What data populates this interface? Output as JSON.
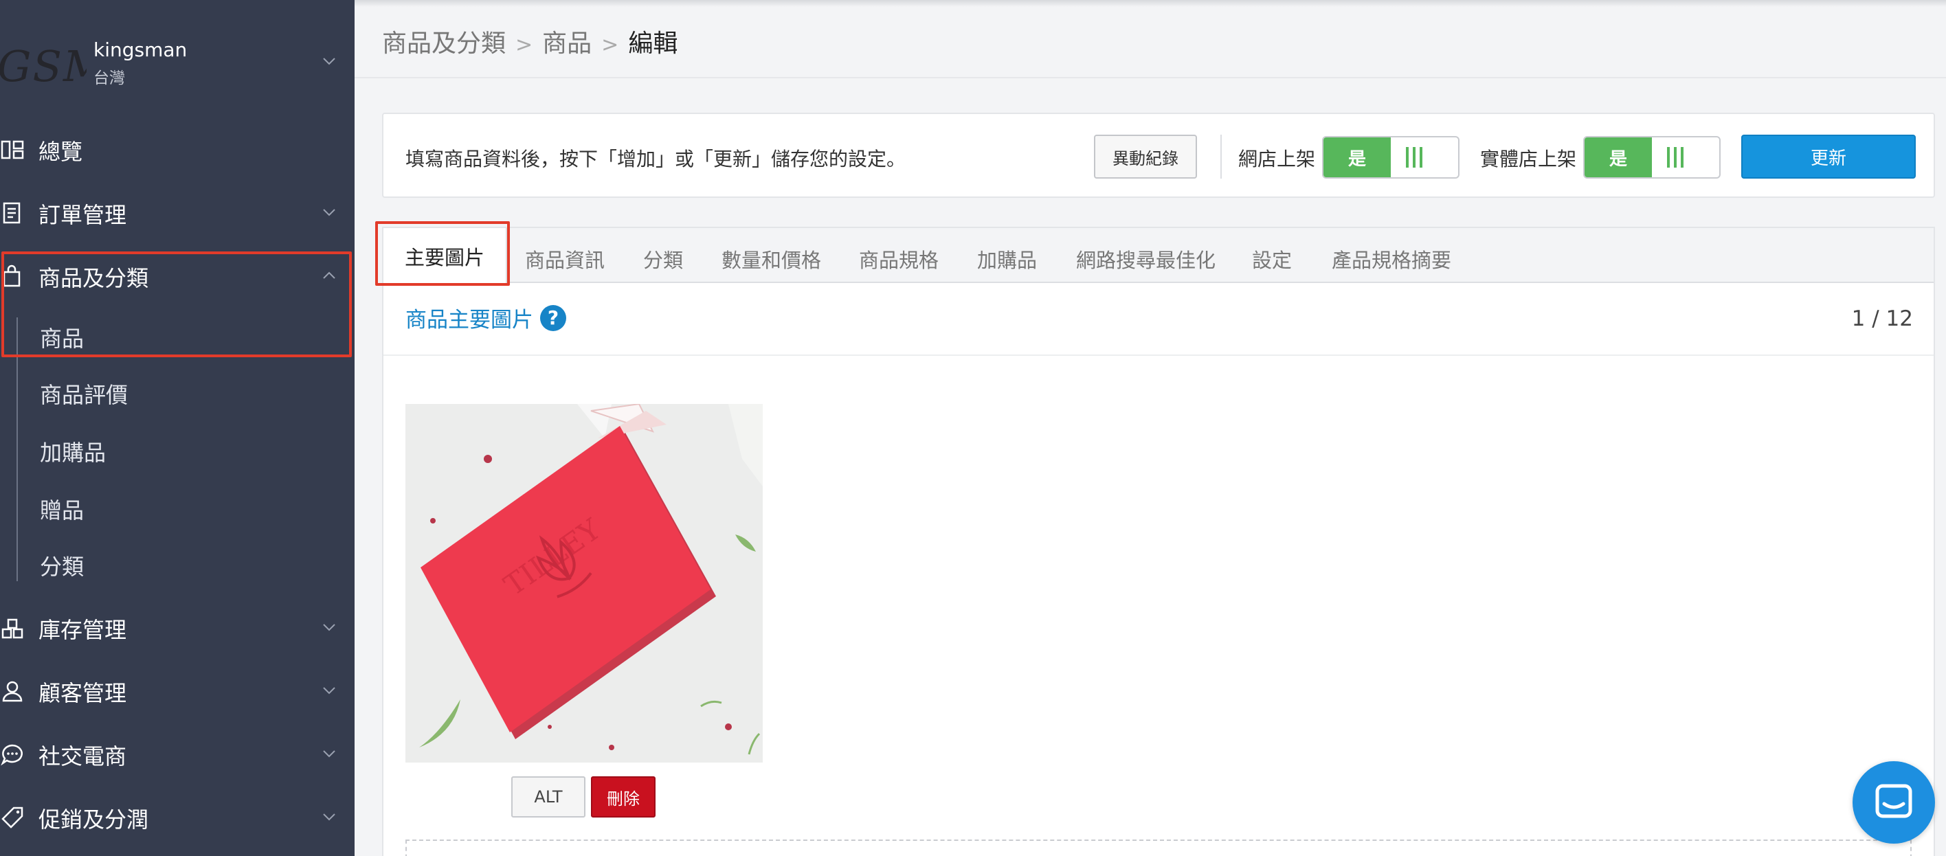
{
  "store": {
    "logo_text": "GSM",
    "name": "kingsman",
    "region": "台灣"
  },
  "sidebar": {
    "items": [
      {
        "label": "總覽",
        "icon": "dashboard-icon"
      },
      {
        "label": "訂單管理",
        "icon": "receipt-icon"
      },
      {
        "label": "商品及分類",
        "icon": "shopping-bag-icon",
        "expanded": true
      },
      {
        "label": "庫存管理",
        "icon": "inventory-icon"
      },
      {
        "label": "顧客管理",
        "icon": "user-icon"
      },
      {
        "label": "社交電商",
        "icon": "chat-icon"
      },
      {
        "label": "促銷及分潤",
        "icon": "tag-icon"
      }
    ],
    "subitems": [
      "商品",
      "商品評價",
      "加購品",
      "贈品",
      "分類"
    ]
  },
  "breadcrumb": {
    "items": [
      "商品及分類",
      "商品"
    ],
    "current": "編輯"
  },
  "action_bar": {
    "instruction": "填寫商品資料後，按下「增加」或「更新」儲存您的設定。",
    "history_button": "異動紀錄",
    "online_label": "網店上架",
    "online_value": "是",
    "store_label": "實體店上架",
    "store_value": "是",
    "update_button": "更新"
  },
  "tabs": [
    "主要圖片",
    "商品資訊",
    "分類",
    "數量和價格",
    "商品規格",
    "加購品",
    "網路搜尋最佳化",
    "設定",
    "產品規格摘要"
  ],
  "active_tab": "主要圖片",
  "section": {
    "title": "商品主要圖片",
    "help": "?",
    "counter": "1 / 12"
  },
  "image": {
    "alt_button": "ALT",
    "delete_button": "刪除",
    "stamp_text": "TILLEY"
  },
  "colors": {
    "sidebar": "#353c4e",
    "accent": "#1694dd",
    "toggle_on": "#57b75b",
    "danger": "#c9111f",
    "highlight": "#e23b2a"
  }
}
